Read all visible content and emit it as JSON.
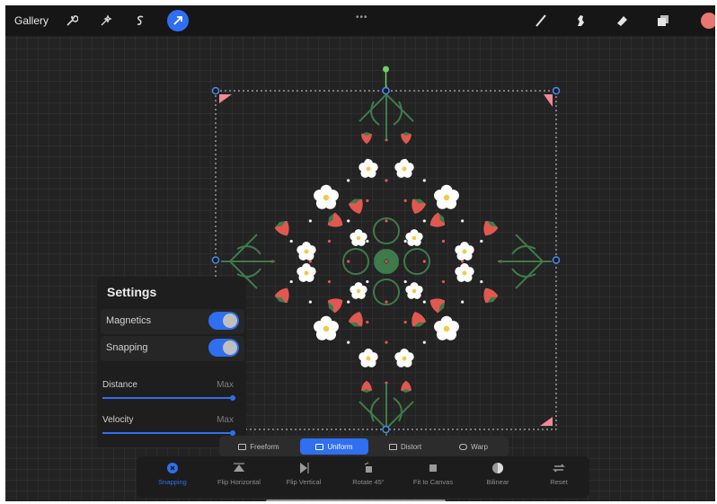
{
  "topbar": {
    "gallery_label": "Gallery",
    "left_icons": [
      "wrench-icon",
      "magic-wand-icon",
      "selection-s-icon",
      "transform-arrow-icon"
    ],
    "center_grip": "•••",
    "right_icons": [
      "brush-icon",
      "smudge-icon",
      "eraser-icon",
      "layers-icon"
    ],
    "active_color": "#e8776f"
  },
  "settings": {
    "title": "Settings",
    "magnetics_label": "Magnetics",
    "magnetics_on": true,
    "snapping_label": "Snapping",
    "snapping_on": true,
    "distance_label": "Distance",
    "distance_max": "Max",
    "distance_value": 1.0,
    "velocity_label": "Velocity",
    "velocity_max": "Max",
    "velocity_value": 1.0
  },
  "modes": {
    "freeform": "Freeform",
    "uniform": "Uniform",
    "distort": "Distort",
    "warp": "Warp",
    "active": "Uniform"
  },
  "toolbar": {
    "snapping": "Snapping",
    "flip_horizontal": "Flip Horizontal",
    "flip_vertical": "Flip Vertical",
    "rotate": "Rotate 45°",
    "fit_to_canvas": "Fit to Canvas",
    "bilinear": "Bilinear",
    "reset": "Reset"
  },
  "colors": {
    "accent": "#2f6ff0",
    "strawberry": "#e0584f",
    "leaf": "#3f7a4a",
    "flower": "#ffffff",
    "flower_center": "#f2c94c"
  }
}
